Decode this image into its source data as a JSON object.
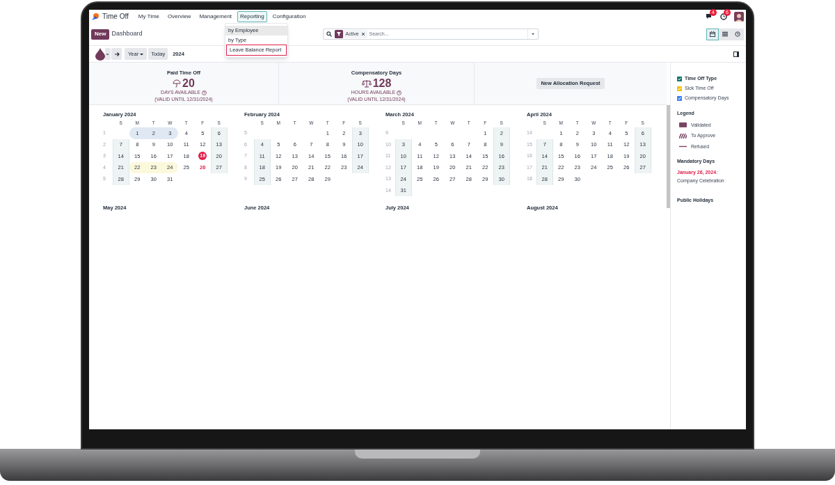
{
  "app": {
    "name": "Time Off",
    "menu": [
      {
        "label": "My Time",
        "selected": false
      },
      {
        "label": "Overview",
        "selected": false
      },
      {
        "label": "Management",
        "selected": false
      },
      {
        "label": "Reporting",
        "selected": true
      },
      {
        "label": "Configuration",
        "selected": false
      }
    ],
    "systray": {
      "messages_badge": "4",
      "activities_badge": "6"
    }
  },
  "reporting_menu": [
    {
      "label": "by Employee",
      "selected": true,
      "highlighted": false
    },
    {
      "label": "by Type",
      "selected": false,
      "highlighted": false
    },
    {
      "label": "Leave Balance Report",
      "selected": false,
      "highlighted": true
    }
  ],
  "control_panel": {
    "new_button": "New",
    "breadcrumb": "Dashboard",
    "search": {
      "facet": "Active",
      "placeholder": "Search..."
    },
    "views": [
      {
        "kind": "calendar",
        "selected": true
      },
      {
        "kind": "list",
        "selected": false
      },
      {
        "kind": "activity",
        "selected": false
      }
    ]
  },
  "toolbar": {
    "range": "Year",
    "today": "Today",
    "period": "2024"
  },
  "summary": [
    {
      "title": "Paid Time Off",
      "amount": "20",
      "unit": "DAYS AVAILABLE",
      "validity": "(VALID UNTIL 12/31/2024)"
    },
    {
      "title": "Compensatory Days",
      "amount": "128",
      "unit": "HOURS AVAILABLE",
      "validity": "(VALID UNTIL 12/31/2024)"
    }
  ],
  "new_allocation": "New Allocation Request",
  "calendar": {
    "months": [
      {
        "title": "January 2024",
        "weekdays": [
          "S",
          "M",
          "T",
          "W",
          "T",
          "F",
          "S"
        ],
        "weeks": [
          {
            "number": "1",
            "starts_mid_week": true,
            "days": [
              {
                "d": "1",
                "kind": "compensatory"
              },
              {
                "d": "2",
                "kind": "compensatory"
              },
              {
                "d": "3",
                "kind": "compensatory"
              },
              "4",
              "5",
              "6"
            ]
          },
          {
            "number": "2",
            "days": [
              "7",
              "8",
              "9",
              "10",
              "11",
              "12",
              "13"
            ]
          },
          {
            "number": "3",
            "days": [
              "14",
              "15",
              "16",
              "17",
              "18",
              {
                "d": "19",
                "kind": "today"
              },
              "20"
            ]
          },
          {
            "number": "4",
            "days": [
              "21",
              {
                "d": "22",
                "kind": "sick"
              },
              {
                "d": "23",
                "kind": "sick"
              },
              {
                "d": "24",
                "kind": "sick"
              },
              "25",
              {
                "d": "26",
                "kind": "mandatory"
              },
              "27"
            ]
          },
          {
            "number": "5",
            "days": [
              "28",
              "29",
              "30",
              "31"
            ]
          }
        ]
      },
      {
        "title": "February 2024",
        "weekdays": [
          "S",
          "M",
          "T",
          "W",
          "T",
          "F",
          "S"
        ],
        "weeks": [
          {
            "number": "5",
            "starts_mid_week": true,
            "days": [
              "1",
              "2",
              "3"
            ]
          },
          {
            "number": "6",
            "days": [
              "4",
              "5",
              "6",
              "7",
              "8",
              "9",
              "10"
            ]
          },
          {
            "number": "7",
            "days": [
              "11",
              "12",
              "13",
              "14",
              "15",
              "16",
              "17"
            ]
          },
          {
            "number": "8",
            "days": [
              "18",
              "19",
              "20",
              "21",
              "22",
              "23",
              "24"
            ]
          },
          {
            "number": "9",
            "days": [
              "25",
              "26",
              "27",
              "28",
              "29"
            ]
          }
        ]
      },
      {
        "title": "March 2024",
        "weekdays": [
          "S",
          "M",
          "T",
          "W",
          "T",
          "F",
          "S"
        ],
        "weeks": [
          {
            "number": "9",
            "starts_mid_week": true,
            "days": [
              "1",
              "2"
            ]
          },
          {
            "number": "10",
            "days": [
              "3",
              "4",
              "5",
              "6",
              "7",
              "8",
              "9"
            ]
          },
          {
            "number": "11",
            "days": [
              "10",
              "11",
              "12",
              "13",
              "14",
              "15",
              "16"
            ]
          },
          {
            "number": "12",
            "days": [
              "17",
              "18",
              "19",
              "20",
              "21",
              "22",
              "23"
            ]
          },
          {
            "number": "13",
            "days": [
              "24",
              "25",
              "26",
              "27",
              "28",
              "29",
              "30"
            ]
          },
          {
            "number": "14",
            "days": [
              "31"
            ]
          }
        ]
      },
      {
        "title": "April 2024",
        "weekdays": [
          "S",
          "M",
          "T",
          "W",
          "T",
          "F",
          "S"
        ],
        "weeks": [
          {
            "number": "14",
            "starts_mid_week": true,
            "days": [
              "1",
              "2",
              "3",
              "4",
              "5",
              "6"
            ]
          },
          {
            "number": "15",
            "days": [
              "7",
              "8",
              "9",
              "10",
              "11",
              "12",
              "13"
            ]
          },
          {
            "number": "16",
            "days": [
              "14",
              "15",
              "16",
              "17",
              "18",
              "19",
              "20"
            ]
          },
          {
            "number": "17",
            "days": [
              "21",
              "22",
              "23",
              "24",
              "25",
              "26",
              "27"
            ]
          },
          {
            "number": "18",
            "days": [
              "28",
              "29",
              "30"
            ]
          }
        ]
      }
    ],
    "more_months": [
      "May 2024",
      "June 2024",
      "July 2024",
      "August 2024"
    ]
  },
  "sidebar": {
    "time_off_types": {
      "title": "Time Off Type",
      "checked": true,
      "items": [
        {
          "label": "Sick Time Off",
          "color": "#f4c20d",
          "checked": true
        },
        {
          "label": "Compensatory Days",
          "color": "#3b82f6",
          "checked": true
        }
      ]
    },
    "legend": {
      "title": "Legend",
      "items": [
        {
          "label": "Validated",
          "kind": "validated"
        },
        {
          "label": "To Approve",
          "kind": "to_approve"
        },
        {
          "label": "Refused",
          "kind": "refused"
        }
      ]
    },
    "mandatory_days": {
      "title": "Mandatory Days",
      "date": "January 26, 2024",
      "separator": ":",
      "description": "Company Celebration"
    },
    "public_holidays": {
      "title": "Public Holidays"
    }
  }
}
